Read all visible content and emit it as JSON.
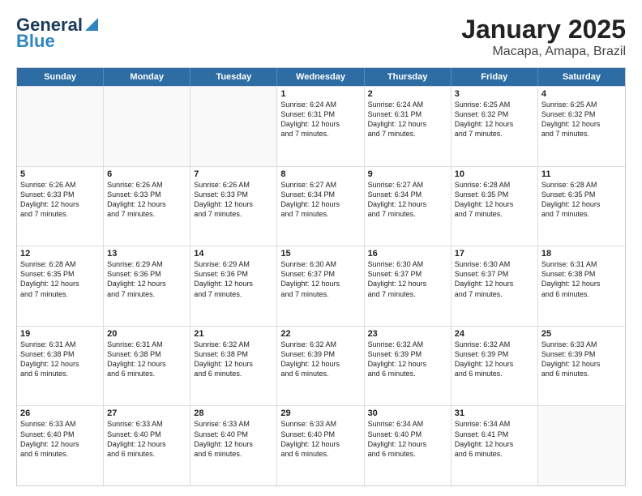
{
  "logo": {
    "line1": "General",
    "line2": "Blue"
  },
  "title": "January 2025",
  "subtitle": "Macapa, Amapa, Brazil",
  "weekdays": [
    "Sunday",
    "Monday",
    "Tuesday",
    "Wednesday",
    "Thursday",
    "Friday",
    "Saturday"
  ],
  "rows": [
    [
      {
        "day": "",
        "info": ""
      },
      {
        "day": "",
        "info": ""
      },
      {
        "day": "",
        "info": ""
      },
      {
        "day": "1",
        "info": "Sunrise: 6:24 AM\nSunset: 6:31 PM\nDaylight: 12 hours\nand 7 minutes."
      },
      {
        "day": "2",
        "info": "Sunrise: 6:24 AM\nSunset: 6:31 PM\nDaylight: 12 hours\nand 7 minutes."
      },
      {
        "day": "3",
        "info": "Sunrise: 6:25 AM\nSunset: 6:32 PM\nDaylight: 12 hours\nand 7 minutes."
      },
      {
        "day": "4",
        "info": "Sunrise: 6:25 AM\nSunset: 6:32 PM\nDaylight: 12 hours\nand 7 minutes."
      }
    ],
    [
      {
        "day": "5",
        "info": "Sunrise: 6:26 AM\nSunset: 6:33 PM\nDaylight: 12 hours\nand 7 minutes."
      },
      {
        "day": "6",
        "info": "Sunrise: 6:26 AM\nSunset: 6:33 PM\nDaylight: 12 hours\nand 7 minutes."
      },
      {
        "day": "7",
        "info": "Sunrise: 6:26 AM\nSunset: 6:33 PM\nDaylight: 12 hours\nand 7 minutes."
      },
      {
        "day": "8",
        "info": "Sunrise: 6:27 AM\nSunset: 6:34 PM\nDaylight: 12 hours\nand 7 minutes."
      },
      {
        "day": "9",
        "info": "Sunrise: 6:27 AM\nSunset: 6:34 PM\nDaylight: 12 hours\nand 7 minutes."
      },
      {
        "day": "10",
        "info": "Sunrise: 6:28 AM\nSunset: 6:35 PM\nDaylight: 12 hours\nand 7 minutes."
      },
      {
        "day": "11",
        "info": "Sunrise: 6:28 AM\nSunset: 6:35 PM\nDaylight: 12 hours\nand 7 minutes."
      }
    ],
    [
      {
        "day": "12",
        "info": "Sunrise: 6:28 AM\nSunset: 6:35 PM\nDaylight: 12 hours\nand 7 minutes."
      },
      {
        "day": "13",
        "info": "Sunrise: 6:29 AM\nSunset: 6:36 PM\nDaylight: 12 hours\nand 7 minutes."
      },
      {
        "day": "14",
        "info": "Sunrise: 6:29 AM\nSunset: 6:36 PM\nDaylight: 12 hours\nand 7 minutes."
      },
      {
        "day": "15",
        "info": "Sunrise: 6:30 AM\nSunset: 6:37 PM\nDaylight: 12 hours\nand 7 minutes."
      },
      {
        "day": "16",
        "info": "Sunrise: 6:30 AM\nSunset: 6:37 PM\nDaylight: 12 hours\nand 7 minutes."
      },
      {
        "day": "17",
        "info": "Sunrise: 6:30 AM\nSunset: 6:37 PM\nDaylight: 12 hours\nand 7 minutes."
      },
      {
        "day": "18",
        "info": "Sunrise: 6:31 AM\nSunset: 6:38 PM\nDaylight: 12 hours\nand 6 minutes."
      }
    ],
    [
      {
        "day": "19",
        "info": "Sunrise: 6:31 AM\nSunset: 6:38 PM\nDaylight: 12 hours\nand 6 minutes."
      },
      {
        "day": "20",
        "info": "Sunrise: 6:31 AM\nSunset: 6:38 PM\nDaylight: 12 hours\nand 6 minutes."
      },
      {
        "day": "21",
        "info": "Sunrise: 6:32 AM\nSunset: 6:38 PM\nDaylight: 12 hours\nand 6 minutes."
      },
      {
        "day": "22",
        "info": "Sunrise: 6:32 AM\nSunset: 6:39 PM\nDaylight: 12 hours\nand 6 minutes."
      },
      {
        "day": "23",
        "info": "Sunrise: 6:32 AM\nSunset: 6:39 PM\nDaylight: 12 hours\nand 6 minutes."
      },
      {
        "day": "24",
        "info": "Sunrise: 6:32 AM\nSunset: 6:39 PM\nDaylight: 12 hours\nand 6 minutes."
      },
      {
        "day": "25",
        "info": "Sunrise: 6:33 AM\nSunset: 6:39 PM\nDaylight: 12 hours\nand 6 minutes."
      }
    ],
    [
      {
        "day": "26",
        "info": "Sunrise: 6:33 AM\nSunset: 6:40 PM\nDaylight: 12 hours\nand 6 minutes."
      },
      {
        "day": "27",
        "info": "Sunrise: 6:33 AM\nSunset: 6:40 PM\nDaylight: 12 hours\nand 6 minutes."
      },
      {
        "day": "28",
        "info": "Sunrise: 6:33 AM\nSunset: 6:40 PM\nDaylight: 12 hours\nand 6 minutes."
      },
      {
        "day": "29",
        "info": "Sunrise: 6:33 AM\nSunset: 6:40 PM\nDaylight: 12 hours\nand 6 minutes."
      },
      {
        "day": "30",
        "info": "Sunrise: 6:34 AM\nSunset: 6:40 PM\nDaylight: 12 hours\nand 6 minutes."
      },
      {
        "day": "31",
        "info": "Sunrise: 6:34 AM\nSunset: 6:41 PM\nDaylight: 12 hours\nand 6 minutes."
      },
      {
        "day": "",
        "info": ""
      }
    ]
  ]
}
